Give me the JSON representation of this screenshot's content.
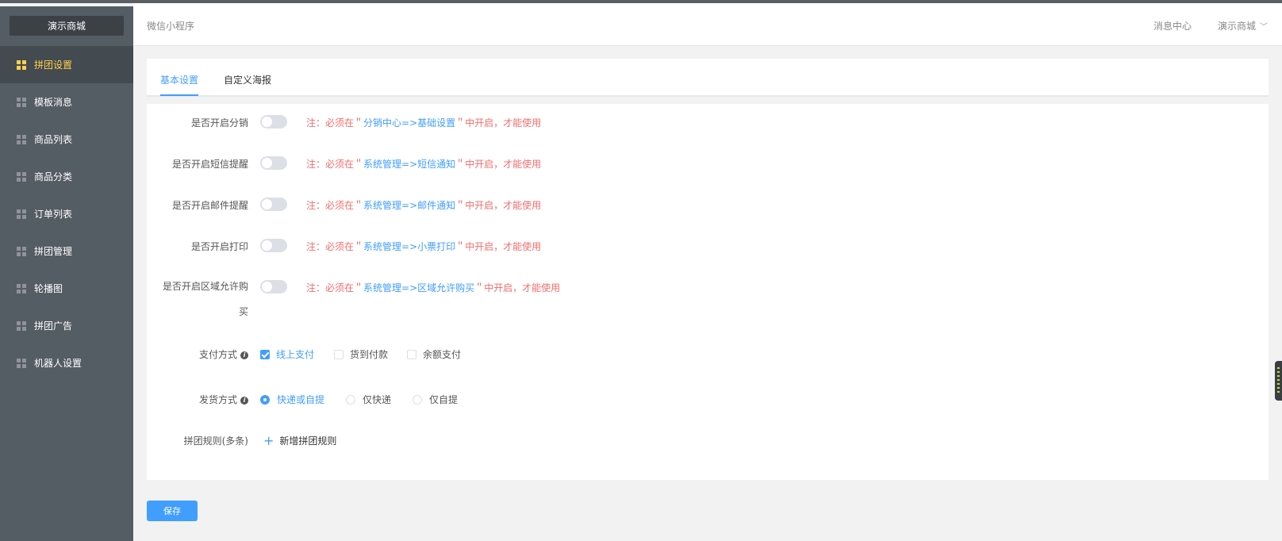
{
  "sidebar": {
    "shop_title": "演示商城",
    "items": [
      {
        "label": "拼团设置",
        "active": true
      },
      {
        "label": "模板消息",
        "active": false
      },
      {
        "label": "商品列表",
        "active": false
      },
      {
        "label": "商品分类",
        "active": false
      },
      {
        "label": "订单列表",
        "active": false
      },
      {
        "label": "拼团管理",
        "active": false
      },
      {
        "label": "轮播图",
        "active": false
      },
      {
        "label": "拼团广告",
        "active": false
      },
      {
        "label": "机器人设置",
        "active": false
      }
    ]
  },
  "header": {
    "breadcrumb": "微信小程序",
    "message_center": "消息中心",
    "shop_menu": "演示商城"
  },
  "tabs": {
    "basic": "基本设置",
    "poster": "自定义海报"
  },
  "form": {
    "distribution": {
      "label": "是否开启分销",
      "enabled": false,
      "note_prefix": "注：必须在＂",
      "note_link": "分销中心=>基础设置",
      "note_suffix": "＂中开启，才能使用"
    },
    "sms": {
      "label": "是否开启短信提醒",
      "enabled": false,
      "note_prefix": "注：必须在＂",
      "note_link": "系统管理=>短信通知",
      "note_suffix": "＂中开启，才能使用"
    },
    "email": {
      "label": "是否开启邮件提醒",
      "enabled": false,
      "note_prefix": "注：必须在＂",
      "note_link": "系统管理=>邮件通知",
      "note_suffix": "＂中开启，才能使用"
    },
    "print": {
      "label": "是否开启打印",
      "enabled": false,
      "note_prefix": "注：必须在＂",
      "note_link": "系统管理=>小票打印",
      "note_suffix": "＂中开启，才能使用"
    },
    "region": {
      "label_line1": "是否开启区域允许购",
      "label_line2": "买",
      "enabled": false,
      "note_prefix": "注：必须在＂",
      "note_link": "系统管理=>区域允许购买",
      "note_suffix": "＂中开启，才能使用"
    },
    "payment": {
      "label": "支付方式",
      "options": [
        {
          "label": "线上支付",
          "checked": true
        },
        {
          "label": "货到付款",
          "checked": false
        },
        {
          "label": "余额支付",
          "checked": false
        }
      ]
    },
    "delivery": {
      "label": "发货方式",
      "options": [
        {
          "label": "快递或自提",
          "selected": true
        },
        {
          "label": "仅快递",
          "selected": false
        },
        {
          "label": "仅自提",
          "selected": false
        }
      ]
    },
    "rules": {
      "label": "拼团规则(多条)",
      "add_label": "新增拼团规则"
    }
  },
  "save_label": "保存",
  "colors": {
    "sidebar_bg": "#545c64",
    "active_text": "#ffd04b",
    "primary": "#409eff",
    "note_red": "#f56c6c"
  }
}
